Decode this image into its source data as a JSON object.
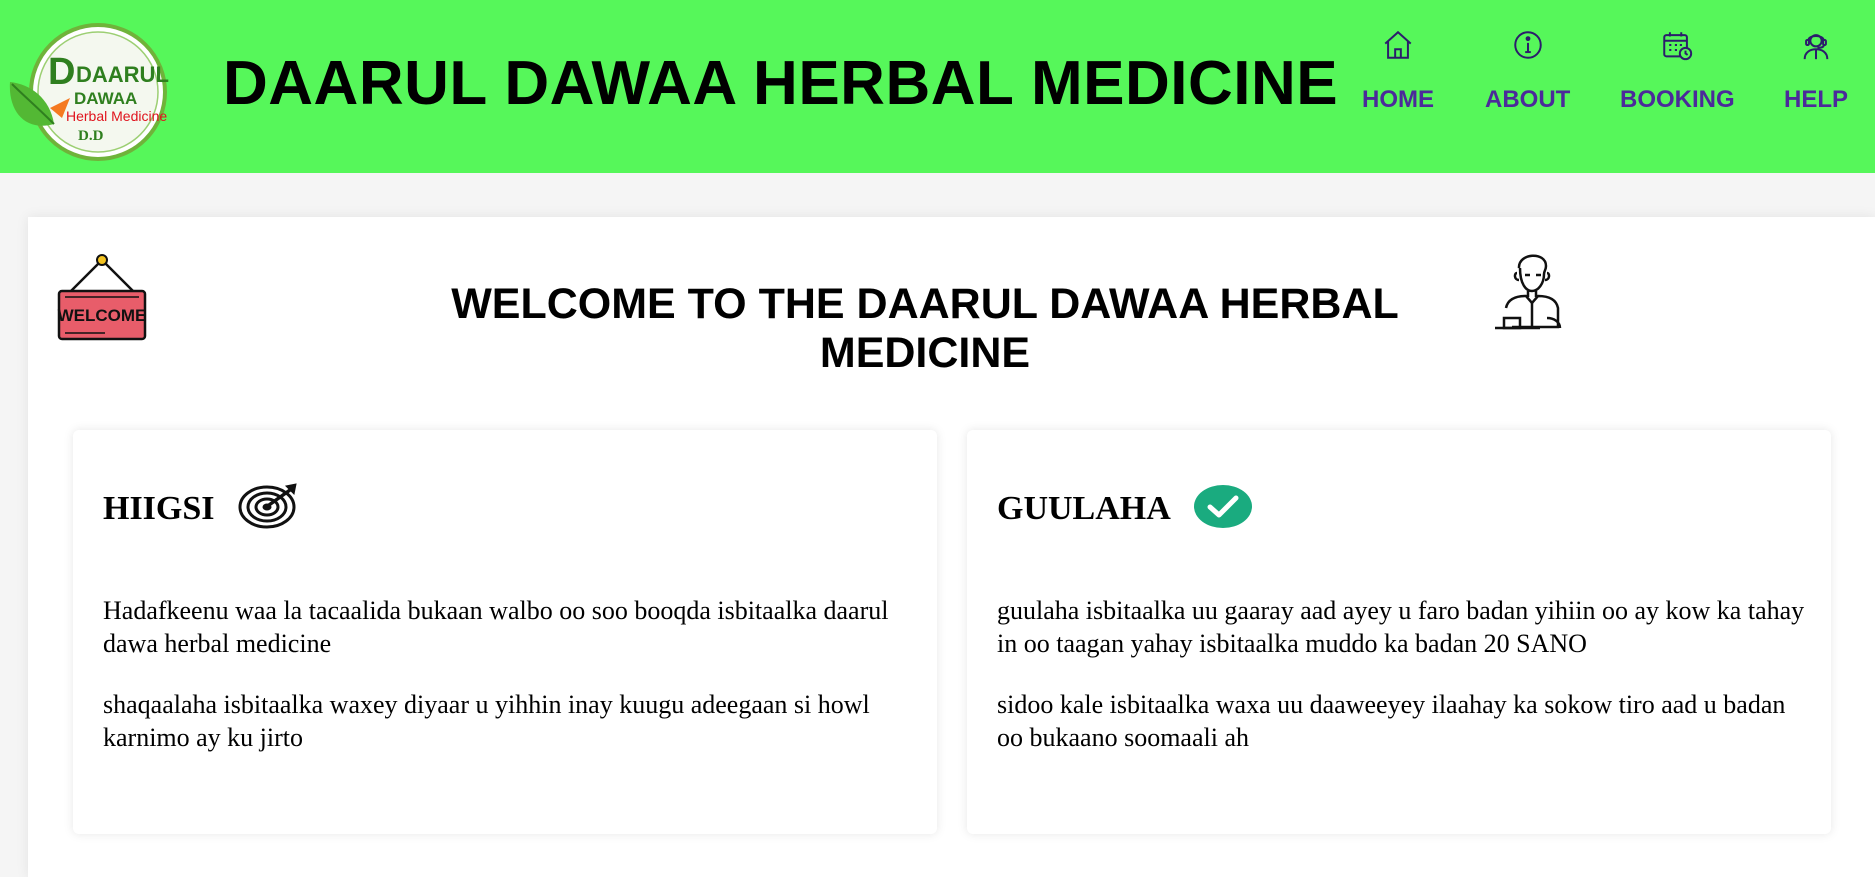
{
  "header": {
    "logo": {
      "line1": "DAARUL",
      "line2": "DAWAA",
      "line3": "Herbal Medicine",
      "line4": "D.D"
    },
    "title": "DAARUL DAWAA HERBAL MEDICINE",
    "nav": [
      {
        "label": "HOME",
        "icon": "home-icon"
      },
      {
        "label": "ABOUT",
        "icon": "info-icon"
      },
      {
        "label": "BOOKING",
        "icon": "calendar-icon"
      },
      {
        "label": "HELP",
        "icon": "support-agent-icon"
      }
    ],
    "background_color": "#56f75a",
    "nav_color": "#4b2a9a"
  },
  "main": {
    "welcome_sign_text": "WELCOME",
    "heading": "WELCOME TO THE DAARUL DAWAA HERBAL MEDICINE",
    "cards": [
      {
        "title": "HIIGSI",
        "icon": "target-icon",
        "paragraphs": [
          "Hadafkeenu waa la tacaalida bukaan walbo oo soo booqda isbitaalka daarul dawa herbal medicine",
          "shaqaalaha isbitaalka waxey diyaar u yihhin inay kuugu adeegaan si howl karnimo ay ku jirto"
        ]
      },
      {
        "title": "GUULAHA",
        "icon": "check-badge-icon",
        "icon_color": "#1aab7f",
        "paragraphs": [
          "guulaha isbitaalka uu gaaray aad ayey u faro badan yihiin oo ay kow ka tahay in oo taagan yahay isbitaalka muddo ka badan 20 SANO",
          "sidoo kale isbitaalka waxa uu daaweeyey ilaahay ka sokow tiro aad u badan oo bukaano soomaali ah"
        ]
      }
    ]
  }
}
